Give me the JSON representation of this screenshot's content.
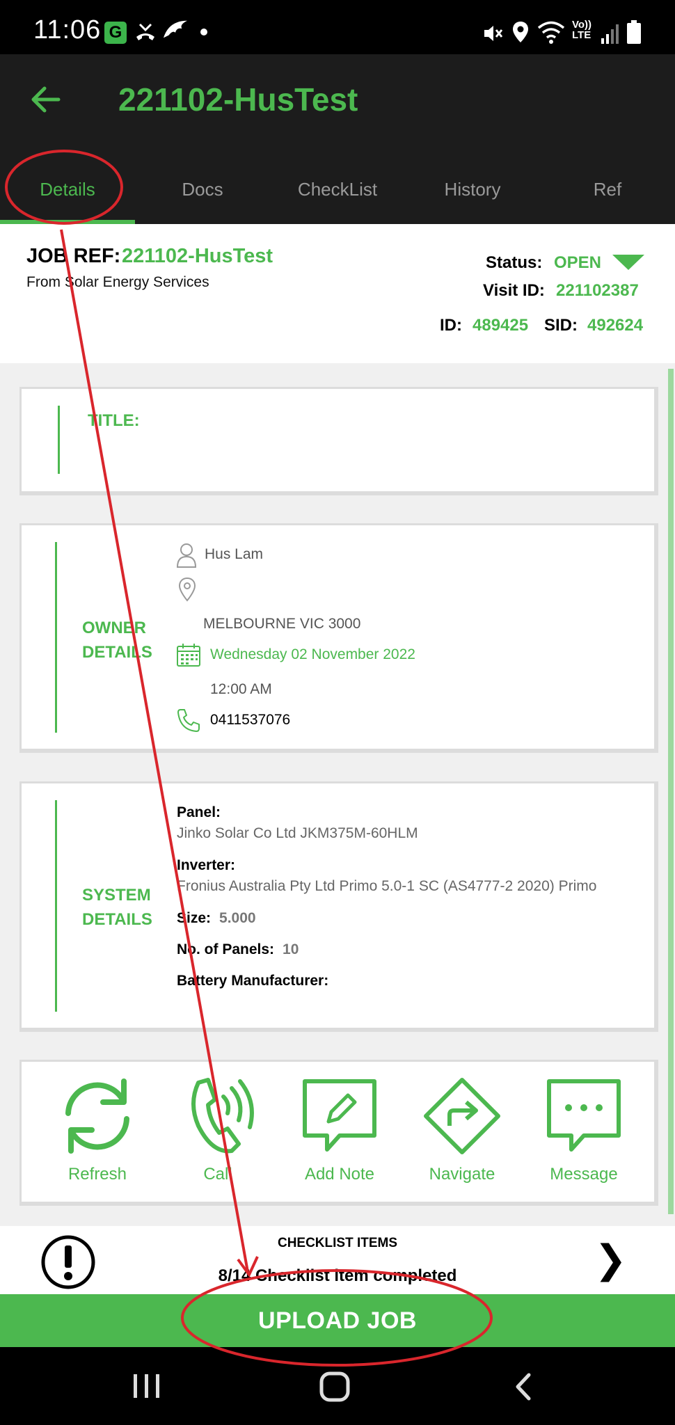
{
  "status_bar": {
    "time": "11:06",
    "carrier_badge": "G",
    "network_label_top": "Vo))",
    "network_label_bottom": "LTE"
  },
  "app_bar": {
    "title": "221102-HusTest",
    "tabs": [
      "Details",
      "Docs",
      "CheckList",
      "History",
      "Ref"
    ],
    "active_tab": "Details"
  },
  "job_header": {
    "job_ref_label": "JOB REF:",
    "job_ref_value": "221102-HusTest",
    "from_text": "From Solar Energy Services",
    "status_label": "Status:",
    "status_value": "OPEN",
    "visit_id_label": "Visit ID:",
    "visit_id_value": "221102387",
    "id_label": "ID:",
    "id_value": "489425",
    "sid_label": "SID:",
    "sid_value": "492624"
  },
  "title_card": {
    "label": "TITLE:"
  },
  "owner_card": {
    "label_line1": "OWNER",
    "label_line2": "DETAILS",
    "name": "Hus Lam",
    "address": "MELBOURNE VIC 3000",
    "date": "Wednesday 02 November 2022",
    "time": "12:00 AM",
    "phone": "0411537076"
  },
  "system_card": {
    "label_line1": "SYSTEM",
    "label_line2": "DETAILS",
    "panel_label": "Panel:",
    "panel_value": "Jinko Solar Co Ltd JKM375M-60HLM",
    "inverter_label": "Inverter:",
    "inverter_value": "Fronius Australia Pty Ltd Primo 5.0-1 SC (AS4777-2 2020) Primo",
    "size_label": "Size:",
    "size_value": "5.000",
    "panels_label": "No. of Panels:",
    "panels_value": "10",
    "battery_label": "Battery Manufacturer:"
  },
  "actions": {
    "refresh": "Refresh",
    "call": "Call",
    "add_note": "Add Note",
    "navigate": "Navigate",
    "message": "Message"
  },
  "checklist": {
    "title": "CHECKLIST ITEMS",
    "progress": "8/14 Checklist item completed",
    "completed": 8,
    "total": 14
  },
  "upload_button": "UPLOAD JOB",
  "colors": {
    "accent": "#4cb84f",
    "annotation": "#d9262c",
    "app_bar": "#1c1c1c"
  }
}
